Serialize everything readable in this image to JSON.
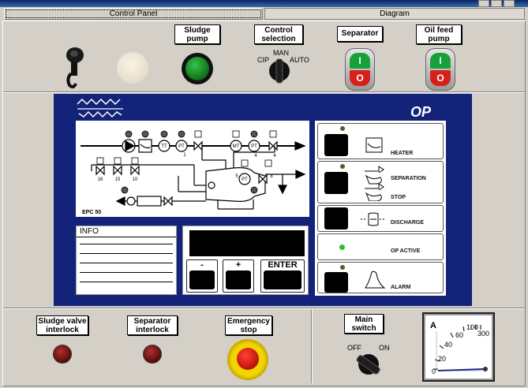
{
  "tabs": {
    "control_panel": "Control Panel",
    "diagram": "Diagram"
  },
  "top_panel": {
    "sludge_pump_label": "Sludge\npump",
    "control_selection_label": "Control\nselection",
    "control_selection_positions": {
      "cip": "CIP",
      "man": "MAN",
      "auto": "AUTO"
    },
    "separator_label": "Separator",
    "oil_feed_pump_label": "Oil feed\npump",
    "start_glyph": "I",
    "stop_glyph": "O"
  },
  "op": {
    "brand": "ALFA LAVAL",
    "title": "OP",
    "epc_label": "EPC 50",
    "info_label": "INFO",
    "diagram_tags": {
      "tt": "TT",
      "pt": "PT",
      "mt": "MT",
      "n1": "1",
      "n4": "4",
      "n4b": "4",
      "n5": "5",
      "n8": "8",
      "n16": "16",
      "n15": "15",
      "n10": "10"
    },
    "keys": {
      "minus": "-",
      "plus": "+",
      "enter": "ENTER"
    },
    "status": {
      "heater": "HEATER",
      "separation": "SEPARATION",
      "stop": "STOP",
      "discharge": "DISCHARGE",
      "op_active": "OP ACTIVE",
      "alarm": "ALARM"
    },
    "colors": {
      "panel_bg": "#13237a",
      "op_active_led": "#22c232"
    }
  },
  "bottom_panel": {
    "sludge_valve_interlock_label": "Sludge valve\ninterlock",
    "separator_interlock_label": "Separator\ninterlock",
    "emergency_stop_label": "Emergency\nstop",
    "main_switch_label": "Main\nswitch",
    "main_switch_positions": {
      "off": "OFF",
      "on": "ON"
    },
    "ammeter": {
      "unit": "A",
      "ticks": [
        "0",
        "20",
        "40",
        "60",
        "100",
        "300"
      ],
      "reading": 0
    }
  }
}
